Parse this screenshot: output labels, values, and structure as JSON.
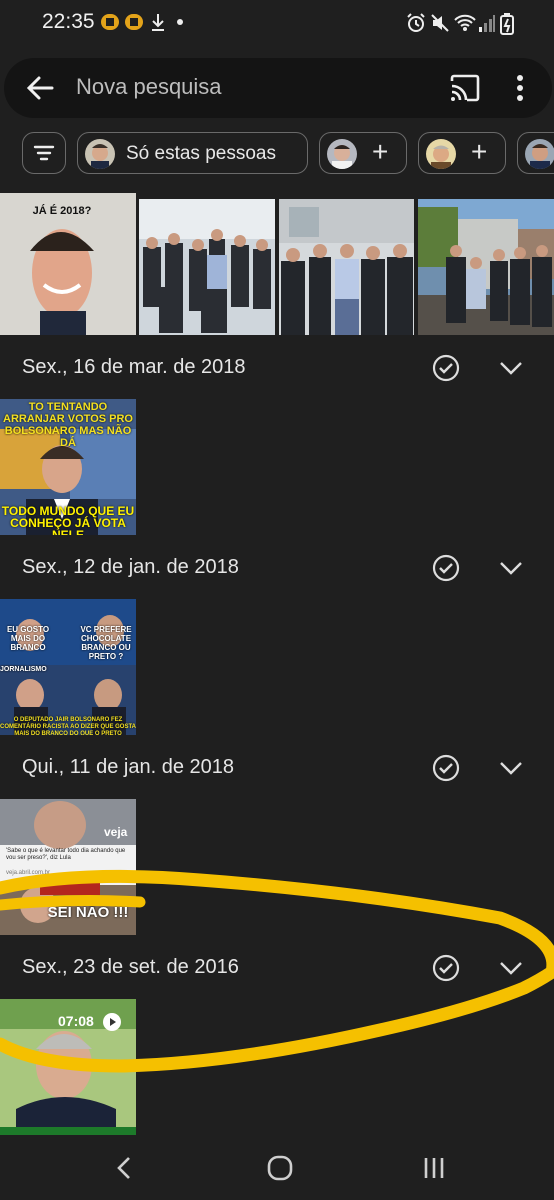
{
  "status_bar": {
    "time": "22:35",
    "icons": [
      "notification-icon",
      "notification-icon",
      "download-icon",
      "dot-icon",
      "alarm-icon",
      "mute-icon",
      "wifi-icon",
      "signal-icon",
      "battery-icon"
    ]
  },
  "search": {
    "placeholder": "Nova pesquisa",
    "icons": [
      "back-arrow-icon",
      "cast-icon",
      "more-vert-icon"
    ]
  },
  "chips": {
    "filter_icon": "filter-icon",
    "selected_label": "Só estas pessoas",
    "add_symbol": "+"
  },
  "groups": [
    {
      "date": "Sex., 16 de mar. de 2018"
    },
    {
      "date": "Sex., 12 de jan. de 2018"
    },
    {
      "date": "Qui., 11 de jan. de 2018"
    },
    {
      "date": "Sex., 23 de set. de 2016"
    }
  ],
  "photo_text": {
    "meme1": "JÁ É 2018?",
    "meme2_top": "TO TENTANDO ARRANJAR VOTOS PRO BOLSONARO MAS NÃO DÁ",
    "meme2_bottom": "TODO MUNDO QUE EU CONHEÇO JÁ VOTA NELE",
    "meme3_a": "EU GOSTO MAIS DO BRANCO",
    "meme3_b": "VC PREFERE CHOCOLATE BRANCO OU PRETO ?",
    "meme3_c": "JORNALISMO",
    "meme3_d": "O DEPUTADO JAIR BOLSONARO FEZ COMENTÁRIO RACISTA AO DIZER QUE GOSTA MAIS DO BRANCO DO QUE O PRETO",
    "meme4_brand": "veja",
    "meme4_caption": "'Sabe o que é levantar todo dia achando que vou ser preso?', diz Lula",
    "meme4_url": "veja.abril.com.br",
    "meme4_bottom": "SEI NÃO !!!",
    "video_duration": "07:08"
  },
  "icons": {
    "check": "check-circle-icon",
    "expand": "chevron-down-icon",
    "play": "play-icon",
    "nav_back": "nav-back-icon",
    "nav_home": "nav-home-icon",
    "nav_recents": "nav-recents-icon"
  },
  "colors": {
    "background": "#1f1f1f",
    "search_bg": "#141414",
    "annotation": "#f5c000"
  }
}
